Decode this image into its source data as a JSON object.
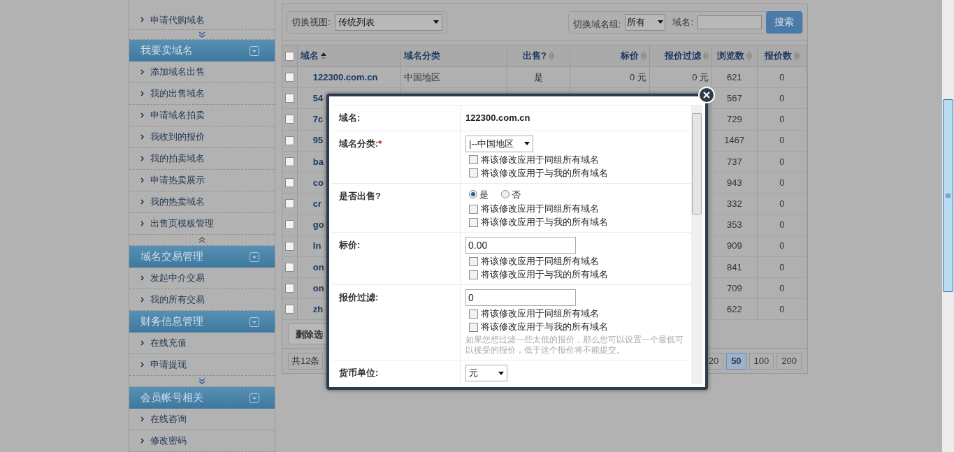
{
  "sidebar": {
    "top_items": [
      {
        "label": "申请代购域名"
      }
    ],
    "sections": [
      {
        "title": "我要卖域名",
        "expanded": true,
        "items": [
          {
            "label": "添加域名出售"
          },
          {
            "label": "我的出售域名"
          },
          {
            "label": "申请域名拍卖"
          },
          {
            "label": "我收到的报价"
          },
          {
            "label": "我的拍卖域名"
          },
          {
            "label": "申请热卖展示"
          },
          {
            "label": "我的热卖域名"
          },
          {
            "label": "出售页模板管理"
          }
        ],
        "collapse_arrow": true,
        "expand_arrow": false
      },
      {
        "title": "域名交易管理",
        "expanded": true,
        "items": [
          {
            "label": "发起中介交易"
          },
          {
            "label": "我的所有交易"
          }
        ],
        "collapse_arrow": false,
        "expand_arrow": false
      },
      {
        "title": "财务信息管理",
        "expanded": true,
        "items": [
          {
            "label": "在线充值"
          },
          {
            "label": "申请提现"
          }
        ],
        "collapse_arrow": false,
        "expand_arrow": true
      },
      {
        "title": "会员帐号相关",
        "expanded": true,
        "items": [
          {
            "label": "在线咨询"
          },
          {
            "label": "修改密码"
          }
        ],
        "collapse_arrow": false,
        "expand_arrow": false
      }
    ]
  },
  "toolbar": {
    "view_label": "切换视图:",
    "view_value": "传统列表",
    "group_label": "切换域名组:",
    "group_value": "所有",
    "domain_label": "域名:",
    "search_button": "搜索"
  },
  "table": {
    "all_checked": false,
    "columns": [
      {
        "label": "域名",
        "sortable": true,
        "sorted": true
      },
      {
        "label": "域名分类",
        "sortable": false
      },
      {
        "label": "出售?",
        "sortable": true,
        "sorted": false
      },
      {
        "label": "标价",
        "sortable": true,
        "sorted": false
      },
      {
        "label": "报价过滤",
        "sortable": true,
        "sorted": false
      },
      {
        "label": "浏览数",
        "sortable": true,
        "sorted": false
      },
      {
        "label": "报价数",
        "sortable": true,
        "sorted": false
      }
    ],
    "rows": [
      {
        "checked": false,
        "cells": [
          "122300.com.cn",
          "中国地区",
          "是",
          "0 元",
          "0 元",
          "621",
          "0"
        ]
      },
      {
        "checked": false,
        "cells": [
          "54",
          "",
          "",
          "",
          "",
          "567",
          "0"
        ]
      },
      {
        "checked": false,
        "cells": [
          "7c",
          "",
          "",
          "",
          "",
          "729",
          "0"
        ]
      },
      {
        "checked": false,
        "cells": [
          "95",
          "",
          "",
          "",
          "",
          "1467",
          "0"
        ]
      },
      {
        "checked": false,
        "cells": [
          "ba",
          "",
          "",
          "",
          "",
          "737",
          "0"
        ]
      },
      {
        "checked": false,
        "cells": [
          "co",
          "",
          "",
          "",
          "",
          "943",
          "0"
        ]
      },
      {
        "checked": false,
        "cells": [
          "cr",
          "",
          "",
          "",
          "",
          "332",
          "0"
        ]
      },
      {
        "checked": false,
        "cells": [
          "go",
          "",
          "",
          "",
          "",
          "353",
          "0"
        ]
      },
      {
        "checked": false,
        "cells": [
          "In",
          "",
          "",
          "",
          "",
          "909",
          "0"
        ]
      },
      {
        "checked": false,
        "cells": [
          "on",
          "",
          "",
          "",
          "",
          "841",
          "0"
        ]
      },
      {
        "checked": false,
        "cells": [
          "on",
          "",
          "",
          "",
          "",
          "709",
          "0"
        ]
      },
      {
        "checked": false,
        "cells": [
          "zh",
          "",
          "",
          "",
          "",
          "622",
          "0"
        ]
      }
    ]
  },
  "delete_button": "删除选",
  "pagination": {
    "total": "共12条",
    "sizes": [
      {
        "label": "20",
        "selected": false
      },
      {
        "label": "50",
        "selected": true
      },
      {
        "label": "100",
        "selected": false
      },
      {
        "label": "200",
        "selected": false
      }
    ]
  },
  "dialog": {
    "fields": [
      {
        "kind": "text",
        "label": "域名:",
        "value": "122300.com.cn"
      },
      {
        "kind": "select",
        "label": "域名分类:",
        "required_mark": "*",
        "value": "|--中国地区",
        "checkboxes": [
          {
            "label": "将该修改应用于同组所有域名",
            "checked": false
          },
          {
            "label": "将该修改应用于与我的所有域名",
            "checked": false
          }
        ]
      },
      {
        "kind": "radio",
        "label": "是否出售?",
        "options": [
          {
            "label": "是",
            "selected": true
          },
          {
            "label": "否",
            "selected": false
          }
        ],
        "checkboxes": [
          {
            "label": "将该修改应用于同组所有域名",
            "checked": false
          },
          {
            "label": "将该修改应用于与我的所有域名",
            "checked": false
          }
        ]
      },
      {
        "kind": "input",
        "label": "标价:",
        "value": "0.00",
        "checkboxes": [
          {
            "label": "将该修改应用于同组所有域名",
            "checked": false
          },
          {
            "label": "将该修改应用于与我的所有域名",
            "checked": false
          }
        ]
      },
      {
        "kind": "input",
        "label": "报价过滤:",
        "value": "0",
        "checkboxes": [
          {
            "label": "将该修改应用于同组所有域名",
            "checked": false
          },
          {
            "label": "将该修改应用于与我的所有域名",
            "checked": false
          }
        ],
        "hint": "如果您想过滤一些太低的报价，那么您可以设置一个最低可以接受的报价，低于这个报价将不能提交。"
      },
      {
        "kind": "select_small",
        "label": "货币单位:",
        "value": "元"
      }
    ]
  }
}
